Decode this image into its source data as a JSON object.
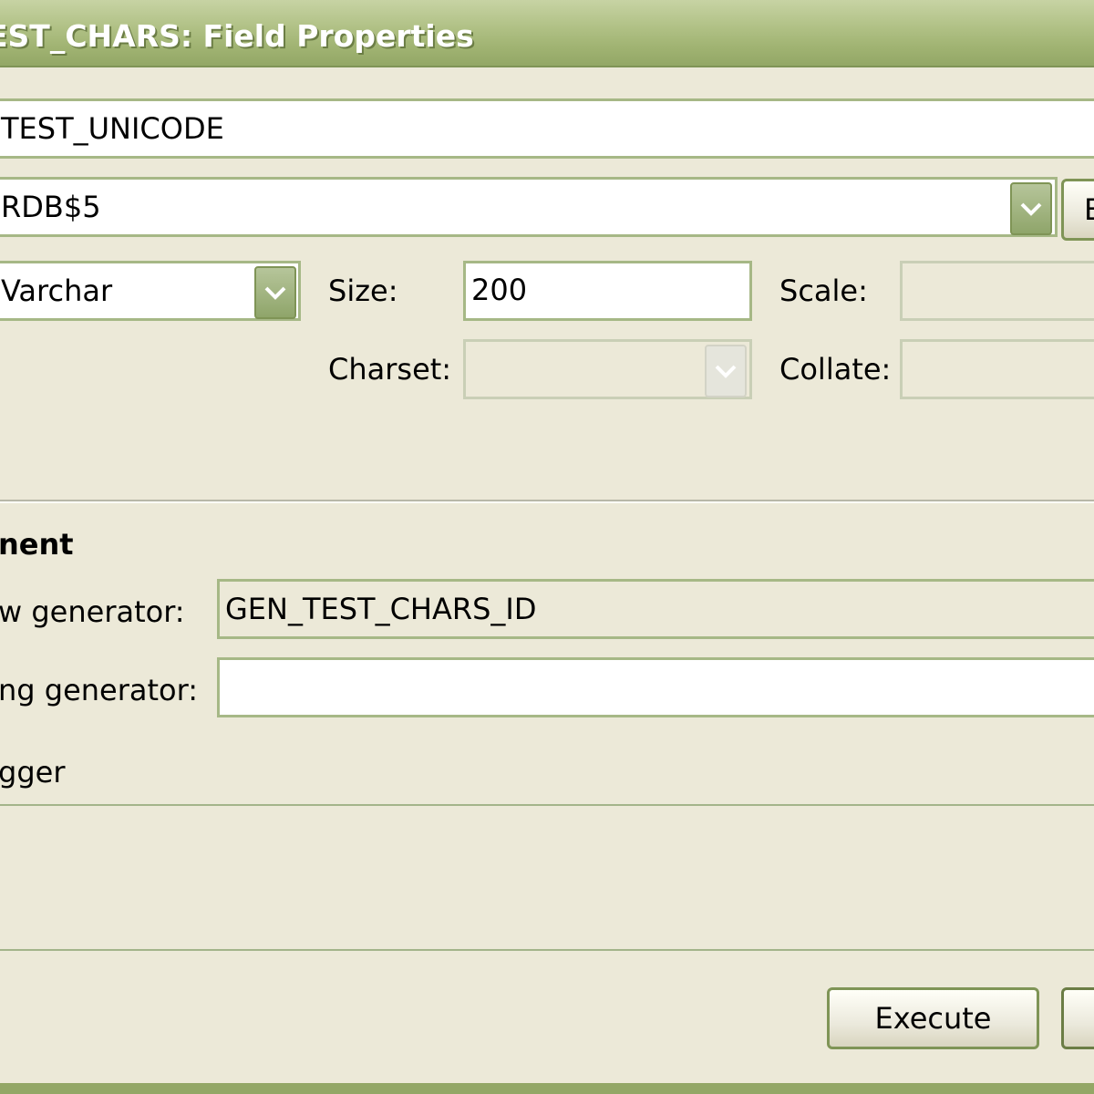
{
  "window": {
    "title": "EST_CHARS: Field Properties"
  },
  "fields": {
    "field_name": "TEST_UNICODE",
    "domain": "RDB$5",
    "datatype": "Varchar",
    "size_label": "Size:",
    "size_value": "200",
    "scale_label": "Scale:",
    "scale_value": "",
    "charset_label": "Charset:",
    "charset_value": "",
    "collate_label": "Collate:",
    "collate_value": ""
  },
  "autoinc": {
    "section_title": "nent",
    "new_generator_label": "w generator:",
    "new_generator_value": "GEN_TEST_CHARS_ID",
    "existing_generator_label": "ng generator:",
    "existing_generator_value": "",
    "trigger_label": "gger"
  },
  "buttons": {
    "domain_edit": "E",
    "execute": "Execute",
    "cancel": ""
  },
  "icons": {
    "dropdown": "chevron-down-icon"
  },
  "colors": {
    "titlebar": "#a1b473",
    "border": "#a6b886",
    "background": "#ECE9D8"
  }
}
